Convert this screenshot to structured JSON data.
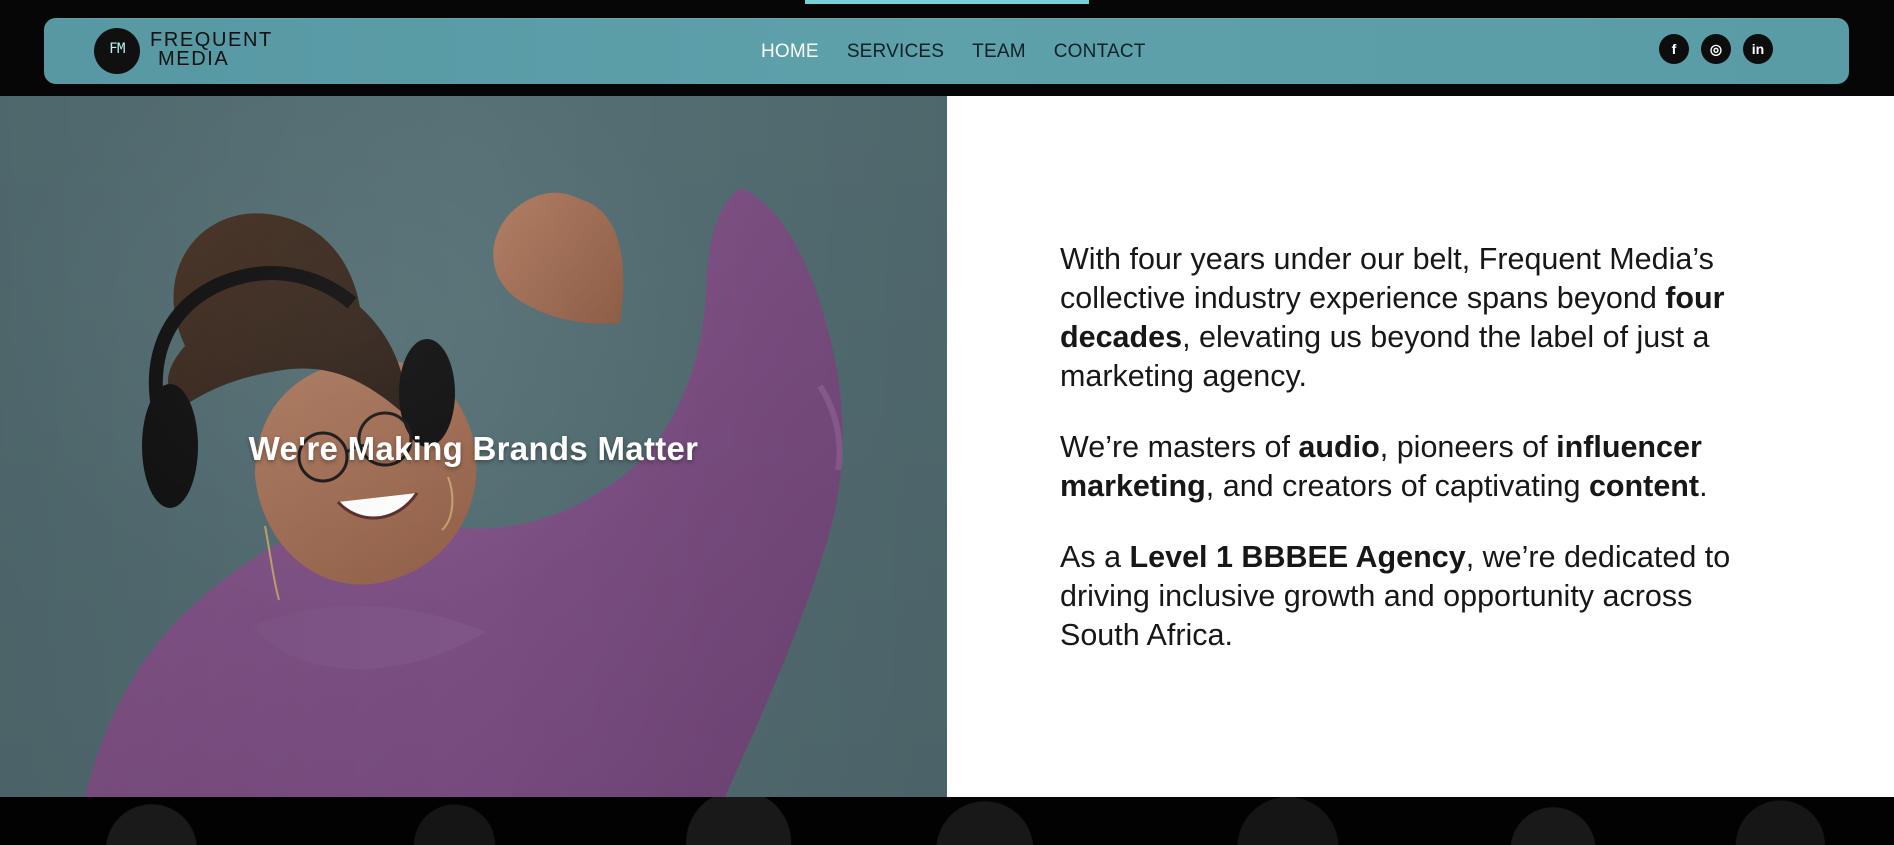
{
  "brand": {
    "logo_mark": "FM",
    "name_line1": "FREQUENT",
    "name_line2": "MEDIA"
  },
  "nav": {
    "items": [
      {
        "label": "HOME",
        "active": true
      },
      {
        "label": "SERVICES",
        "active": false
      },
      {
        "label": "TEAM",
        "active": false
      },
      {
        "label": "CONTACT",
        "active": false
      }
    ]
  },
  "social": {
    "facebook": "f",
    "instagram": "◎",
    "linkedin": "in"
  },
  "hero": {
    "title": "We're Making Brands Matter"
  },
  "content": {
    "paragraph1": {
      "text1": "With four years under our belt, Frequent Media’s collective industry experience spans beyond ",
      "bold1": "four decades",
      "text2": ", elevating us beyond the label of just a marketing agency."
    },
    "paragraph2": {
      "text1": "We’re masters of ",
      "bold1": "audio",
      "text2": ", pioneers of ",
      "bold2": "influencer marketing",
      "text3": ", and creators of captivating ",
      "bold3": "content",
      "text4": "."
    },
    "paragraph3": {
      "text1": "As a ",
      "bold1": "Level 1 BBBEE Agency",
      "text2": ", we’re dedicated to driving inclusive growth and opportunity across South Africa."
    }
  },
  "colors": {
    "nav_bg": "#5ea1ab",
    "top_indicator": "#79d1d6",
    "hero_bg": "#557075"
  },
  "icons": {
    "facebook": "facebook-icon",
    "instagram": "instagram-icon",
    "linkedin": "linkedin-icon"
  }
}
